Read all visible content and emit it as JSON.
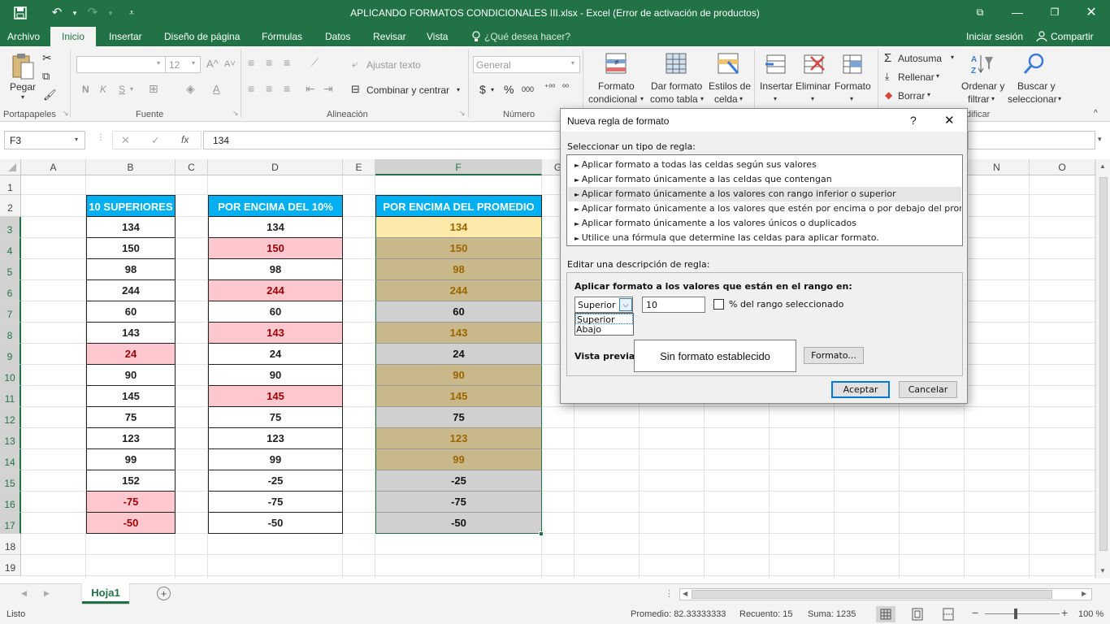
{
  "window": {
    "title": "APLICANDO FORMATOS CONDICIONALES III.xlsx - Excel (Error de activación de productos)"
  },
  "menu": {
    "tabs": [
      "Archivo",
      "Inicio",
      "Insertar",
      "Diseño de página",
      "Fórmulas",
      "Datos",
      "Revisar",
      "Vista"
    ],
    "tell_me": "¿Qué desea hacer?",
    "sign_in": "Iniciar sesión",
    "share": "Compartir"
  },
  "ribbon": {
    "groups": {
      "clipboard": "Portapapeles",
      "font": "Fuente",
      "alignment": "Alineación",
      "number": "Número",
      "editing_partial": "dificar"
    },
    "paste": "Pegar",
    "font_size": "12",
    "bold": "N",
    "italic": "K",
    "underline": "S",
    "wrap_text": "Ajustar texto",
    "merge_center": "Combinar y centrar",
    "number_format": "General",
    "currency": "$",
    "percent": "%",
    "thousands": "000",
    "cond_format": [
      "Formato",
      "condicional"
    ],
    "format_table": [
      "Dar formato",
      "como tabla"
    ],
    "cell_styles": [
      "Estilos de",
      "celda"
    ],
    "insert": "Insertar",
    "delete": "Eliminar",
    "format": "Formato",
    "autosum": "Autosuma",
    "fill": "Rellenar",
    "clear": "Borrar",
    "sort_filter": [
      "Ordenar y",
      "filtrar"
    ],
    "find_select": [
      "Buscar y",
      "seleccionar"
    ]
  },
  "formula_bar": {
    "name_box": "F3",
    "fx": "fx",
    "value": "134"
  },
  "sheet": {
    "columns": [
      "A",
      "B",
      "C",
      "D",
      "E",
      "F",
      "G",
      "N",
      "O"
    ],
    "rows": [
      "1",
      "2",
      "3",
      "4",
      "5",
      "6",
      "7",
      "8",
      "9",
      "10",
      "11",
      "12",
      "13",
      "14",
      "15",
      "16",
      "17",
      "18",
      "19"
    ],
    "headers": {
      "B": "10 SUPERIORES",
      "D": "POR ENCIMA DEL 10%",
      "F": "POR ENCIMA DEL PROMEDIO"
    },
    "colB": [
      "134",
      "150",
      "98",
      "244",
      "60",
      "143",
      "24",
      "90",
      "145",
      "75",
      "123",
      "99",
      "152",
      "-75",
      "-50"
    ],
    "colD": [
      "134",
      "150",
      "98",
      "244",
      "60",
      "143",
      "24",
      "90",
      "145",
      "75",
      "123",
      "99",
      "-25",
      "-75",
      "-50"
    ],
    "colF": [
      "134",
      "150",
      "98",
      "244",
      "60",
      "143",
      "24",
      "90",
      "145",
      "75",
      "123",
      "99",
      "-25",
      "-75",
      "-50"
    ],
    "tab_name": "Hoja1"
  },
  "colors": {
    "excel_green": "#217346",
    "header_blue": "#00b0f0",
    "pink_fill": "#ffc7ce",
    "pink_text": "#9c0006",
    "tan_fill": "#c8b88a",
    "tan_text": "#9c6500",
    "gray_fill": "#d0d0d0",
    "yellow_fill": "#fde9a9"
  },
  "dialog": {
    "title": "Nueva regla de formato",
    "help": "?",
    "select_label": "Seleccionar un tipo de regla:",
    "rules": [
      "Aplicar formato a todas las celdas según sus valores",
      "Aplicar formato únicamente a las celdas que contengan",
      "Aplicar formato únicamente a los valores con rango inferior o superior",
      "Aplicar formato únicamente a los valores que estén por encima o por debajo del promedio",
      "Aplicar formato únicamente a los valores únicos o duplicados",
      "Utilice una fórmula que determine las celdas para aplicar formato."
    ],
    "edit_label": "Editar una descripción de regla:",
    "apply_label": "Aplicar formato a los valores que están en el rango en:",
    "rank_selected": "Superior",
    "rank_options": [
      "Superior",
      "Abajo"
    ],
    "rank_value": "10",
    "percent_label": "% del rango seleccionado",
    "preview_label": "Vista previa:",
    "preview_text": "Sin formato establecido",
    "format_button": "Formato...",
    "ok": "Aceptar",
    "cancel": "Cancelar"
  },
  "status": {
    "ready": "Listo",
    "average": "Promedio: 82.33333333",
    "count": "Recuento: 15",
    "sum": "Suma: 1235",
    "zoom": "100 %"
  }
}
